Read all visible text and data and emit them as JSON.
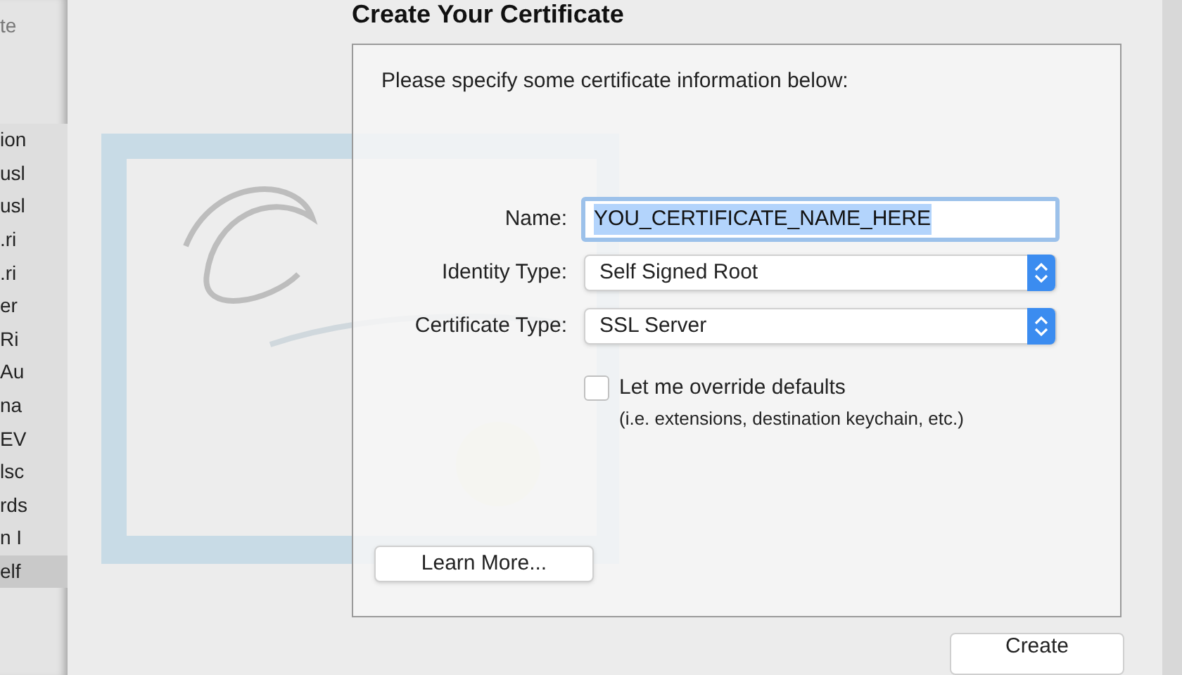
{
  "background_list": {
    "header": "te",
    "items": [
      {
        "text": "ion",
        "selected": false
      },
      {
        "text": "usl",
        "selected": false
      },
      {
        "text": "usl",
        "selected": false
      },
      {
        "text": ".ri",
        "selected": false
      },
      {
        "text": ".ri",
        "selected": false
      },
      {
        "text": "er",
        "selected": false
      },
      {
        "text": "Ri",
        "selected": false
      },
      {
        "text": "Au",
        "selected": false
      },
      {
        "text": "na",
        "selected": false
      },
      {
        "text": "EV",
        "selected": false
      },
      {
        "text": "lsc",
        "selected": false
      },
      {
        "text": "rds",
        "selected": false
      },
      {
        "text": "n I",
        "selected": false
      },
      {
        "text": "elf",
        "selected": true
      }
    ]
  },
  "dialog": {
    "title": "Create Your Certificate",
    "instructions": "Please specify some certificate information below:",
    "fields": [
      {
        "kind": "text",
        "label": "Name:",
        "value": "YOU_CERTIFICATE_NAME_HERE",
        "focused": true
      },
      {
        "kind": "popup",
        "label": "Identity Type:",
        "value": "Self Signed Root"
      },
      {
        "kind": "popup",
        "label": "Certificate Type:",
        "value": "SSL Server"
      }
    ],
    "override": {
      "label": "Let me override defaults",
      "note": "(i.e. extensions, destination keychain, etc.)",
      "checked": false
    },
    "learn_more": "Learn More...",
    "create": "Create"
  }
}
